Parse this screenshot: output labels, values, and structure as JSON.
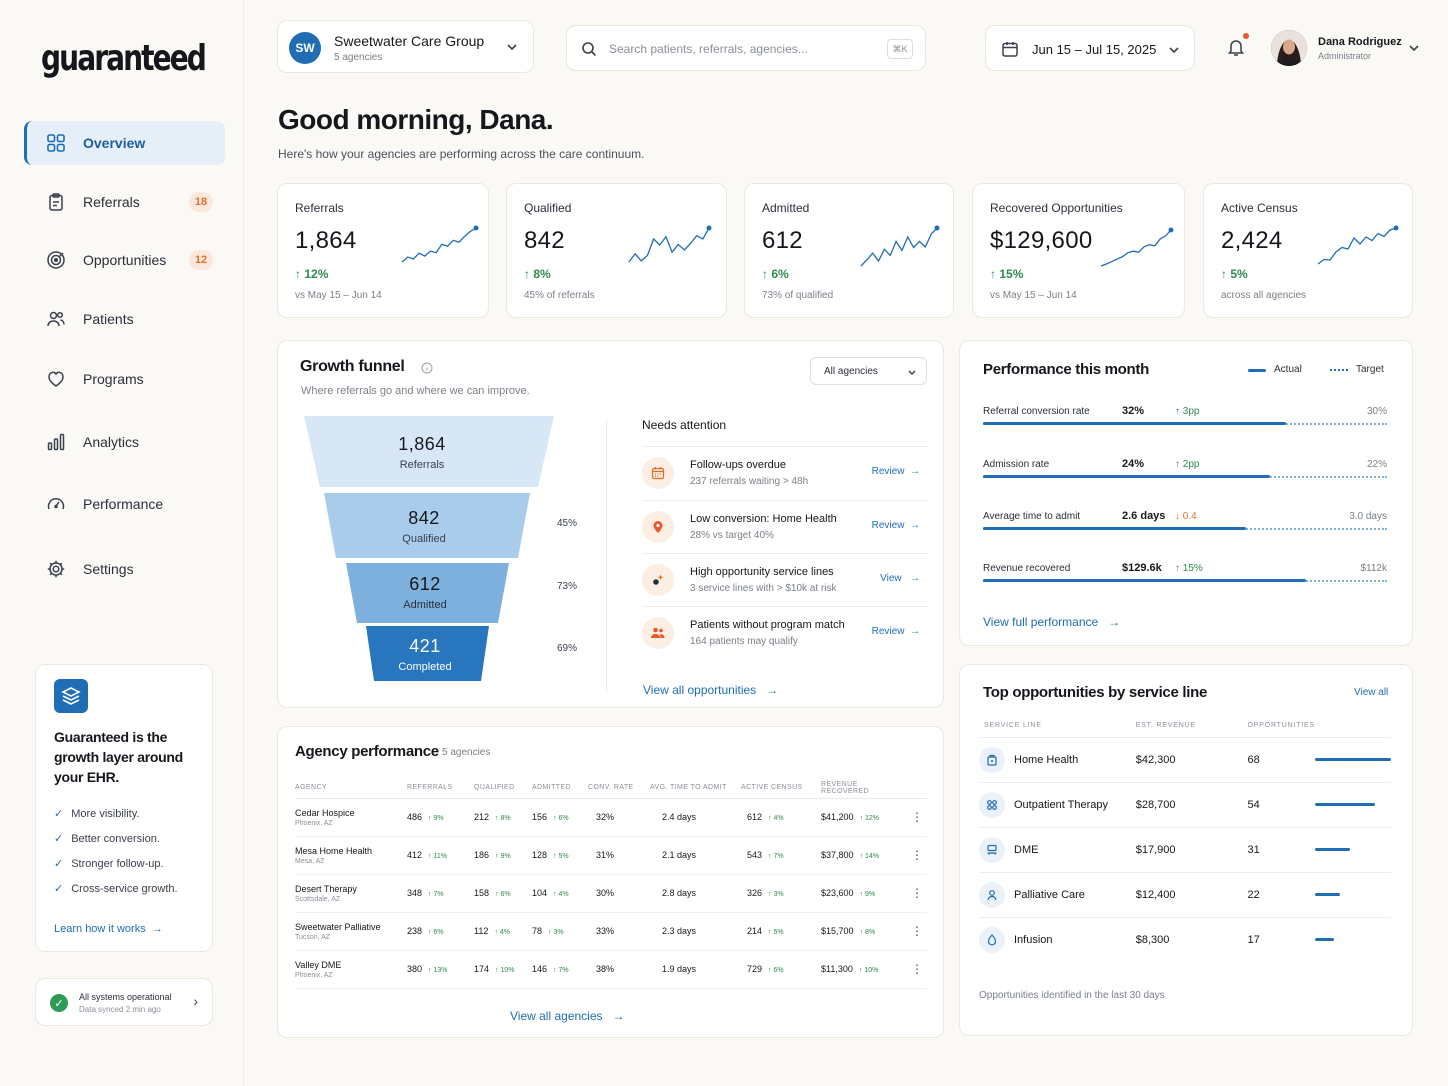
{
  "app": {
    "logo": "guaranteed"
  },
  "sidebar": {
    "items": [
      {
        "label": "Overview",
        "icon": "grid-icon",
        "active": true
      },
      {
        "label": "Referrals",
        "icon": "clipboard-icon",
        "badge": "18"
      },
      {
        "label": "Opportunities",
        "icon": "target-icon",
        "badge": "12"
      },
      {
        "label": "Patients",
        "icon": "users-icon"
      },
      {
        "label": "Programs",
        "icon": "heart-icon"
      },
      {
        "label": "Analytics",
        "icon": "bar-chart-icon"
      },
      {
        "label": "Performance",
        "icon": "gauge-icon"
      },
      {
        "label": "Settings",
        "icon": "gear-icon"
      }
    ],
    "promo": {
      "title": "Guaranteed is the growth layer around your EHR.",
      "bullets": [
        "More visibility.",
        "Better conversion.",
        "Stronger follow-up.",
        "Cross-service growth."
      ],
      "link": "Learn how it works"
    },
    "status": {
      "title": "All systems operational",
      "sub": "Data synced 2 min ago"
    }
  },
  "header": {
    "org": {
      "initials": "SW",
      "name": "Sweetwater Care Group",
      "sub": "5 agencies"
    },
    "search": {
      "placeholder": "Search patients, referrals, agencies...",
      "shortcut": "⌘K"
    },
    "date_range": "Jun 15 – Jul 15, 2025",
    "user": {
      "name": "Dana Rodriguez",
      "role": "Administrator"
    }
  },
  "greeting": {
    "title": "Good morning, Dana.",
    "subtitle": "Here's how your agencies are performing across the care continuum."
  },
  "kpis": [
    {
      "label": "Referrals",
      "value": "1,864",
      "change": "12%",
      "sub": "vs May 15 – Jun 14",
      "trend": [
        2,
        3,
        2.6,
        3.8,
        3.2,
        4.2,
        3.9,
        5.6,
        5.2,
        6.4,
        6.0,
        7.2,
        8.2,
        8.9
      ]
    },
    {
      "label": "Qualified",
      "value": "842",
      "change": "8%",
      "sub": "45% of referrals",
      "trend": [
        3,
        4.5,
        3.2,
        4.2,
        7.2,
        6.1,
        7.6,
        4.8,
        6.2,
        5.2,
        6.4,
        7.8,
        7.2,
        9.2
      ]
    },
    {
      "label": "Admitted",
      "value": "612",
      "change": "6%",
      "sub": "73% of qualified",
      "trend": [
        2.5,
        3.6,
        4.8,
        3.4,
        5.5,
        4.4,
        6.9,
        5.3,
        7.7,
        5.8,
        6.9,
        5.9,
        8.2,
        9.3
      ]
    },
    {
      "label": "Recovered Opportunities",
      "value": "$129,600",
      "change": "15%",
      "sub": "vs May 15 – Jun 14",
      "trend": [
        2,
        2.4,
        2.9,
        3.4,
        3.9,
        4.7,
        5.0,
        4.8,
        5.9,
        6.3,
        6.1,
        7.5,
        8.1,
        9.3
      ]
    },
    {
      "label": "Active Census",
      "value": "2,424",
      "change": "5%",
      "sub": "across all agencies",
      "trend": [
        2.2,
        3.1,
        3.0,
        4.6,
        5.5,
        5.2,
        7.4,
        6.2,
        7.6,
        6.9,
        8.3,
        7.7,
        9.0,
        9.4
      ]
    }
  ],
  "funnel": {
    "title": "Growth funnel",
    "subtitle": "Where referrals go and where we can improve.",
    "filter": "All agencies",
    "stages": [
      {
        "value": "1,864",
        "label": "Referrals",
        "rate": ""
      },
      {
        "value": "842",
        "label": "Qualified",
        "rate": "45%"
      },
      {
        "value": "612",
        "label": "Admitted",
        "rate": "73%"
      },
      {
        "value": "421",
        "label": "Completed",
        "rate": "69%"
      }
    ],
    "attention": {
      "title": "Needs attention",
      "items": [
        {
          "title": "Follow-ups overdue",
          "sub": "237 referrals waiting > 48h",
          "action": "Review",
          "icon": "calendar-icon"
        },
        {
          "title": "Low conversion: Home Health",
          "sub": "28% vs target 40%",
          "action": "Review",
          "icon": "location-pin-icon"
        },
        {
          "title": "High opportunity service lines",
          "sub": "3 service lines with > $10k at risk",
          "action": "View",
          "icon": "sparkle-icon"
        },
        {
          "title": "Patients without program match",
          "sub": "164 patients may qualify",
          "action": "Review",
          "icon": "group-icon"
        }
      ],
      "link": "View all opportunities"
    }
  },
  "performance": {
    "title": "Performance this month",
    "legend": {
      "actual": "Actual",
      "target": "Target"
    },
    "rows": [
      {
        "label": "Referral conversion rate",
        "value": "32%",
        "change": "3pp",
        "dir": "up",
        "target": "30%",
        "progress": 0.75
      },
      {
        "label": "Admission rate",
        "value": "24%",
        "change": "2pp",
        "dir": "up",
        "target": "22%",
        "progress": 0.71
      },
      {
        "label": "Average time to admit",
        "value": "2.6 days",
        "change": "0.4",
        "dir": "down",
        "target": "3.0 days",
        "progress": 0.65
      },
      {
        "label": "Revenue recovered",
        "value": "$129.6k",
        "change": "15%",
        "dir": "up",
        "target": "$112k",
        "progress": 0.8
      }
    ],
    "link": "View full performance"
  },
  "agencies": {
    "title": "Agency performance",
    "count": "5 agencies",
    "columns": [
      "AGENCY",
      "REFERRALS",
      "QUALIFIED",
      "ADMITTED",
      "CONV. RATE",
      "AVG. TIME TO ADMIT",
      "ACTIVE CENSUS",
      "REVENUE RECOVERED"
    ],
    "rows": [
      {
        "name": "Cedar Hospice",
        "loc": "Phoenix, AZ",
        "ref": "486",
        "ref_c": "9%",
        "qual": "212",
        "qual_c": "8%",
        "adm": "156",
        "adm_c": "6%",
        "conv": "32%",
        "time": "2.4 days",
        "census": "612",
        "census_c": "4%",
        "rev": "$41,200",
        "rev_c": "12%"
      },
      {
        "name": "Mesa Home Health",
        "loc": "Mesa, AZ",
        "ref": "412",
        "ref_c": "11%",
        "qual": "186",
        "qual_c": "9%",
        "adm": "128",
        "adm_c": "5%",
        "conv": "31%",
        "time": "2.1 days",
        "census": "543",
        "census_c": "7%",
        "rev": "$37,800",
        "rev_c": "14%"
      },
      {
        "name": "Desert Therapy",
        "loc": "Scottsdale, AZ",
        "ref": "348",
        "ref_c": "7%",
        "qual": "158",
        "qual_c": "6%",
        "adm": "104",
        "adm_c": "4%",
        "conv": "30%",
        "time": "2.8 days",
        "census": "326",
        "census_c": "3%",
        "rev": "$23,600",
        "rev_c": "9%"
      },
      {
        "name": "Sweetwater Palliative",
        "loc": "Tucson, AZ",
        "ref": "238",
        "ref_c": "6%",
        "qual": "112",
        "qual_c": "4%",
        "adm": "78",
        "adm_c": "3%",
        "conv": "33%",
        "time": "2.3 days",
        "census": "214",
        "census_c": "5%",
        "rev": "$15,700",
        "rev_c": "8%"
      },
      {
        "name": "Valley DME",
        "loc": "Phoenix, AZ",
        "ref": "380",
        "ref_c": "13%",
        "qual": "174",
        "qual_c": "10%",
        "adm": "146",
        "adm_c": "7%",
        "conv": "38%",
        "time": "1.9 days",
        "census": "729",
        "census_c": "6%",
        "rev": "$11,300",
        "rev_c": "10%"
      }
    ],
    "link": "View all agencies"
  },
  "top_opps": {
    "title": "Top opportunities by service line",
    "view_all": "View all",
    "columns": [
      "SERVICE LINE",
      "EST. REVENUE",
      "OPPORTUNITIES"
    ],
    "rows": [
      {
        "name": "Home Health",
        "rev": "$42,300",
        "opps": "68",
        "icon": "house-icon"
      },
      {
        "name": "Outpatient Therapy",
        "rev": "$28,700",
        "opps": "54",
        "icon": "therapy-icon"
      },
      {
        "name": "DME",
        "rev": "$17,900",
        "opps": "31",
        "icon": "equipment-icon"
      },
      {
        "name": "Palliative Care",
        "rev": "$12,400",
        "opps": "22",
        "icon": "person-icon"
      },
      {
        "name": "Infusion",
        "rev": "$8,300",
        "opps": "17",
        "icon": "droplet-icon"
      }
    ],
    "footer": "Opportunities identified in the last 30 days"
  },
  "colors": {
    "accent": "#1f6db5",
    "positive": "#2e8a4e",
    "warning": "#e2702f"
  }
}
